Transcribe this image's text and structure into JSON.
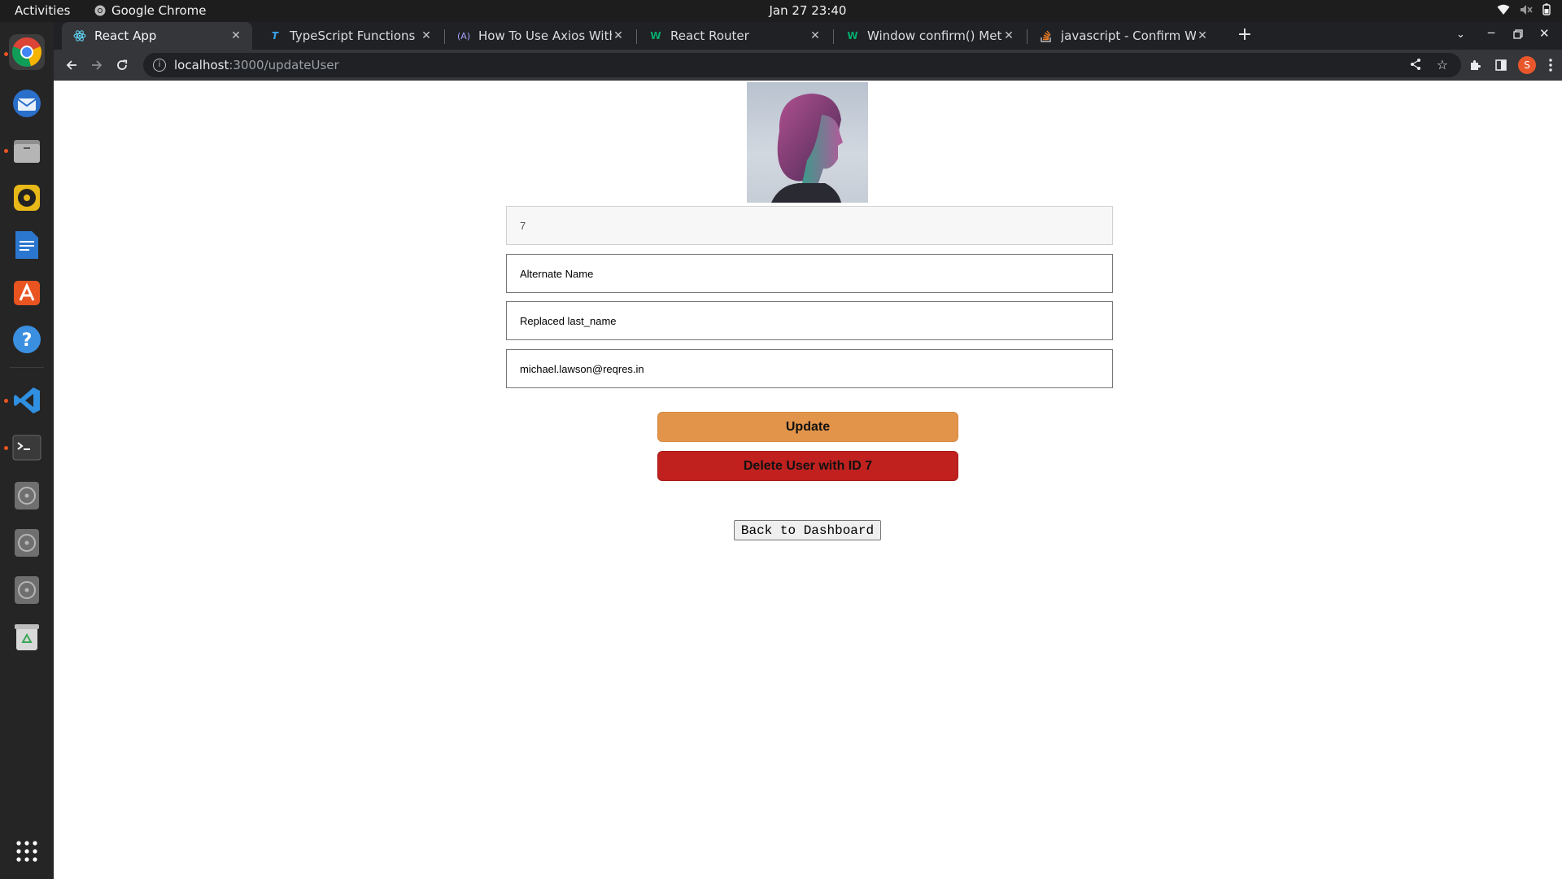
{
  "system": {
    "activities": "Activities",
    "app_name": "Google Chrome",
    "clock": "Jan 27  23:40"
  },
  "dock": {
    "items": [
      "chrome-icon",
      "thunderbird-icon",
      "files-icon",
      "rhythmbox-icon",
      "libreoffice-writer-icon",
      "app-center-icon",
      "help-icon",
      "vscode-icon",
      "terminal-icon",
      "disc-icon",
      "disc-icon",
      "disc-icon",
      "trash-icon",
      "app-grid-icon"
    ]
  },
  "browser": {
    "tabs": [
      {
        "title": "React App",
        "active": true
      },
      {
        "title": "TypeScript Functions",
        "active": false
      },
      {
        "title": "How To Use Axios With Re",
        "active": false
      },
      {
        "title": "React Router",
        "active": false
      },
      {
        "title": "Window confirm() Metho",
        "active": false
      },
      {
        "title": "javascript - Confirm Wind",
        "active": false
      }
    ],
    "url_host": "localhost",
    "url_path": ":3000/updateUser",
    "profile_initial": "S"
  },
  "form": {
    "id_value": "7",
    "first_name_value": "Alternate Name",
    "last_name_value": "Replaced last_name",
    "email_value": "michael.lawson@reqres.in",
    "update_label": "Update",
    "delete_label": "Delete User with ID 7",
    "back_label": "Back to Dashboard"
  },
  "colors": {
    "update_button": "#e2944a",
    "delete_button": "#c0211f",
    "dock_accent": "#e95420"
  }
}
